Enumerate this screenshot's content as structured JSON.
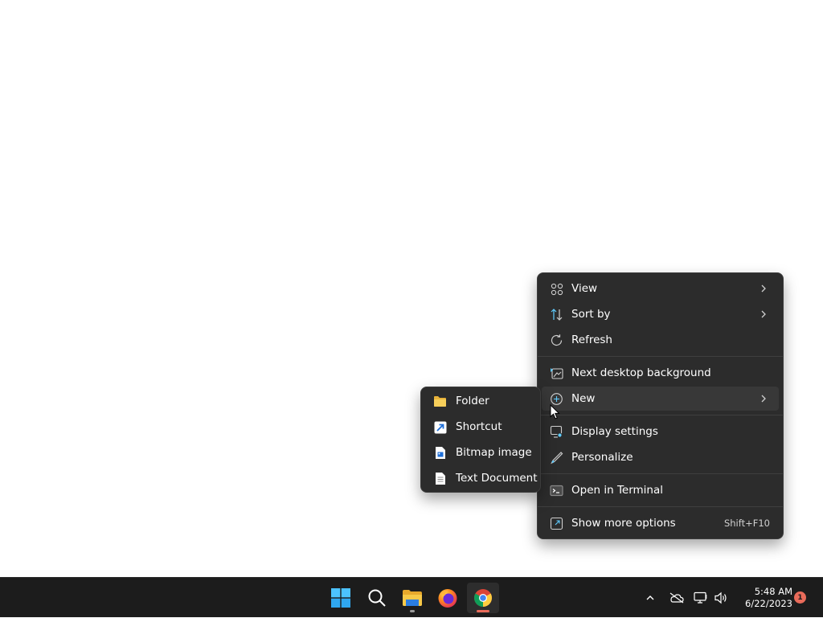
{
  "context_menu": {
    "items": [
      {
        "label": "View",
        "icon": "view-grid-icon",
        "has_submenu": true
      },
      {
        "label": "Sort by",
        "icon": "sort-icon",
        "has_submenu": true
      },
      {
        "label": "Refresh",
        "icon": "refresh-icon",
        "has_submenu": false
      },
      {
        "label": "Next desktop background",
        "icon": "next-background-icon",
        "has_submenu": false
      },
      {
        "label": "New",
        "icon": "new-plus-icon",
        "has_submenu": true,
        "highlighted": true
      },
      {
        "label": "Display settings",
        "icon": "display-settings-icon",
        "has_submenu": false
      },
      {
        "label": "Personalize",
        "icon": "personalize-pen-icon",
        "has_submenu": false
      },
      {
        "label": "Open in Terminal",
        "icon": "terminal-icon",
        "has_submenu": false
      },
      {
        "label": "Show more options",
        "icon": "show-more-options-icon",
        "shortcut": "Shift+F10"
      }
    ]
  },
  "new_submenu": {
    "items": [
      {
        "label": "Folder",
        "icon": "folder-icon"
      },
      {
        "label": "Shortcut",
        "icon": "shortcut-icon"
      },
      {
        "label": "Bitmap image",
        "icon": "bitmap-image-icon"
      },
      {
        "label": "Text Document",
        "icon": "text-document-icon"
      }
    ]
  },
  "taskbar": {
    "apps": [
      {
        "name": "Start",
        "icon": "windows-start-icon"
      },
      {
        "name": "Search",
        "icon": "search-icon"
      },
      {
        "name": "File Explorer",
        "icon": "file-explorer-icon",
        "running": true
      },
      {
        "name": "Firefox",
        "icon": "firefox-icon"
      },
      {
        "name": "Chrome",
        "icon": "chrome-icon",
        "running": true,
        "active": true
      }
    ],
    "tray": {
      "icons": [
        "chevron-up-icon",
        "onedrive-offline-icon",
        "network-icon",
        "volume-icon"
      ],
      "time": "5:48 AM",
      "date": "6/22/2023",
      "notification_count": "1"
    }
  },
  "colors": {
    "menu_background": "#2c2c2c",
    "menu_hover": "#383838",
    "taskbar_background": "#1c1c1c",
    "accent_blue": "#60cdff",
    "chrome_indicator": "#e96b5a",
    "notification_badge": "#e96b5a"
  }
}
